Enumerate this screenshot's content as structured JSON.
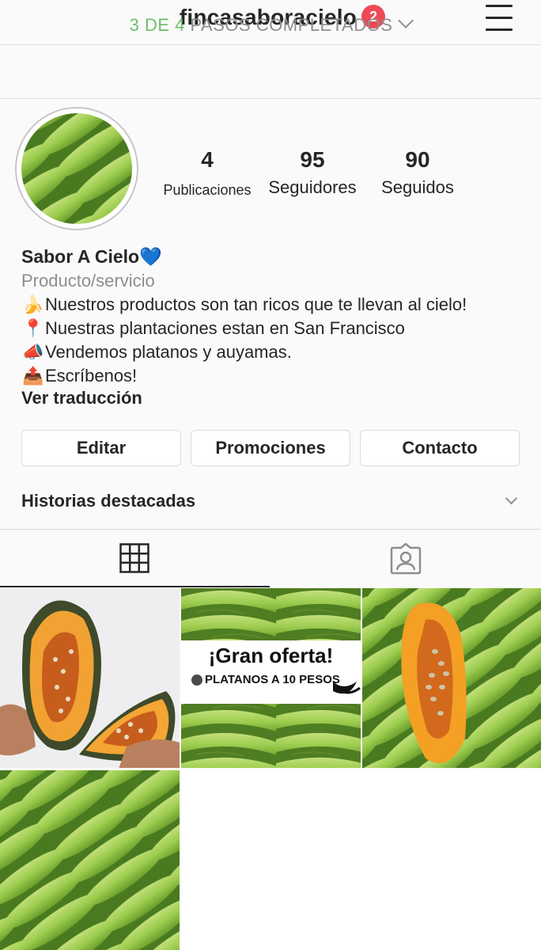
{
  "header": {
    "username": "fincasaboracielo",
    "notification_count": "2",
    "menu_icon": "hamburger-menu-icon"
  },
  "steps": {
    "progress": "3 DE 4",
    "label": "PASOS COMPLETADOS"
  },
  "profile": {
    "stats": [
      {
        "value": "4",
        "label": "Publicaciones"
      },
      {
        "value": "95",
        "label": "Seguidores"
      },
      {
        "value": "90",
        "label": "Seguidos"
      }
    ],
    "name": "Sabor A Cielo",
    "name_emoji": "💙",
    "category": "Producto/servicio",
    "bio": [
      {
        "emoji": "🍌",
        "text": "Nuestros productos son tan ricos que te llevan al cielo!"
      },
      {
        "emoji": "📍",
        "text": "Nuestras plantaciones estan en San Francisco"
      },
      {
        "emoji": "📣",
        "text": "Vendemos platanos y auyamas."
      },
      {
        "emoji": "📤",
        "text": "Escríbenos!"
      }
    ],
    "translate": "Ver traducción"
  },
  "buttons": {
    "edit": "Editar",
    "promotions": "Promociones",
    "contact": "Contacto"
  },
  "highlights": {
    "label": "Historias destacadas"
  },
  "tabs": {
    "grid_icon": "grid-icon",
    "tagged_icon": "tagged-person-icon"
  },
  "posts": {
    "offer_title": "¡Gran oferta!",
    "offer_subtitle": "PLATANOS A 10 PESOS"
  },
  "colors": {
    "accent_green": "#6ebd6a",
    "badge_red": "#ed4956",
    "banana_green": "#9fcf5a",
    "pumpkin_orange": "#f29b1f"
  }
}
